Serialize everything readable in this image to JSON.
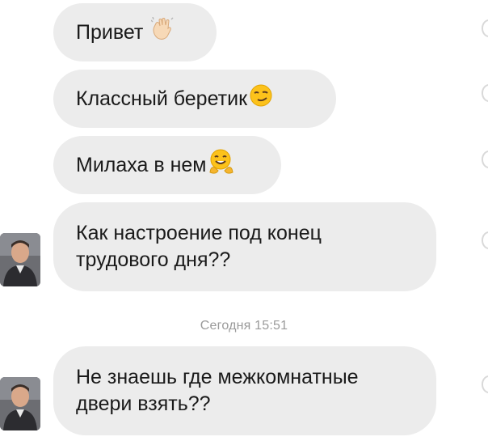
{
  "chat": {
    "messages": [
      {
        "text": "Привет",
        "emoji": "waving-hand-emoji"
      },
      {
        "text": "Классный беретик",
        "emoji": "smirking-face-emoji"
      },
      {
        "text": "Милаха в нем",
        "emoji": "hugging-face-emoji"
      },
      {
        "text": "Как настроение под конец трудового дня??"
      },
      {
        "text": "Не знаешь где межкомнатные двери взять??"
      }
    ],
    "timestamp": "Сегодня 15:51"
  },
  "colors": {
    "bubble_bg": "#ececec",
    "text": "#1a1a1a",
    "timestamp": "#9a9a9a",
    "background": "#ffffff"
  }
}
